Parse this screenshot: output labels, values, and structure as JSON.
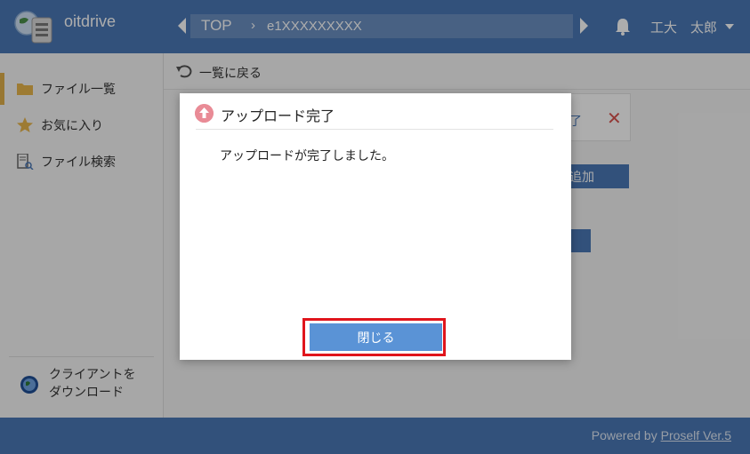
{
  "header": {
    "app_title": "oitdrive",
    "breadcrumb": {
      "root": "TOP",
      "separator": "›",
      "current": "e1XXXXXXXXX"
    },
    "user_name": "工大　太郎"
  },
  "sidebar": {
    "items": [
      {
        "label": "ファイル一覧",
        "icon": "folder-icon",
        "active": true
      },
      {
        "label": "お気に入り",
        "icon": "star-icon",
        "active": false
      },
      {
        "label": "ファイル検索",
        "icon": "file-search-icon",
        "active": false
      }
    ],
    "client_download": {
      "line1": "クライアントを",
      "line2": "ダウンロード",
      "icon": "globe-icon"
    }
  },
  "main": {
    "back_label": "一覧に戻る",
    "bg_fragment_text": "了",
    "bg_button_text": "追加"
  },
  "modal": {
    "title": "アップロード完了",
    "message": "アップロードが完了しました。",
    "close_label": "閉じる"
  },
  "footer": {
    "powered_prefix": "Powered by",
    "powered_link": "Proself Ver.5"
  },
  "colors": {
    "header": "#4a78b5",
    "button": "#5a93d6",
    "highlight": "#e0151c",
    "upload_icon": "#e98b96"
  }
}
